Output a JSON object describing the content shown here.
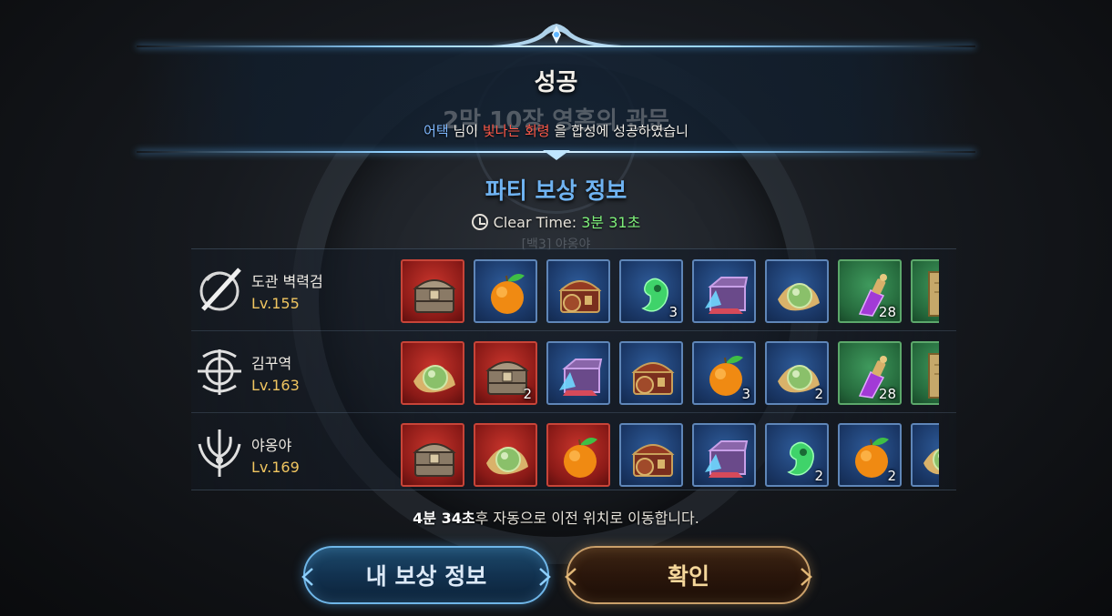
{
  "header": {
    "title": "성공",
    "ghost_title": "2막 10장 영혼의 관문",
    "notice": {
      "player": "어택",
      "pre": " 님이 ",
      "item": "빛나는 회령",
      "post": " 을 합성에 성공하였습니"
    }
  },
  "party": {
    "title": "파티 보상 정보",
    "clear_time_label": "Clear Time: ",
    "clear_time_value": "3분 31초",
    "ghost_sub": "[백3] 야옹야"
  },
  "members": [
    {
      "name": "도관 벽력검",
      "level": "Lv.155",
      "class_icon": "dragon-sword-icon",
      "items": [
        {
          "icon": "treasure-chest-icon",
          "bg": "red",
          "count": ""
        },
        {
          "icon": "orange-fruit-icon",
          "bg": "blue",
          "count": ""
        },
        {
          "icon": "ornate-chest-icon",
          "bg": "blue",
          "count": ""
        },
        {
          "icon": "jade-magatama-icon",
          "bg": "blue",
          "count": "3"
        },
        {
          "icon": "crystal-box-icon",
          "bg": "blue",
          "count": ""
        },
        {
          "icon": "green-pearl-icon",
          "bg": "blue",
          "count": ""
        },
        {
          "icon": "purple-potion-icon",
          "bg": "green",
          "count": "28"
        },
        {
          "icon": "scroll-icon",
          "bg": "green",
          "count": ""
        }
      ]
    },
    {
      "name": "김꾸역",
      "level": "Lv.163",
      "class_icon": "bow-emblem-icon",
      "items": [
        {
          "icon": "green-pearl-icon",
          "bg": "red",
          "count": ""
        },
        {
          "icon": "treasure-chest-icon",
          "bg": "red",
          "count": "2"
        },
        {
          "icon": "crystal-box-icon",
          "bg": "blue",
          "count": ""
        },
        {
          "icon": "ornate-chest-icon",
          "bg": "blue",
          "count": ""
        },
        {
          "icon": "orange-fruit-icon",
          "bg": "blue",
          "count": "3"
        },
        {
          "icon": "green-pearl-icon",
          "bg": "blue",
          "count": "2"
        },
        {
          "icon": "purple-potion-icon",
          "bg": "green",
          "count": "28"
        },
        {
          "icon": "scroll-icon",
          "bg": "green",
          "count": ""
        }
      ]
    },
    {
      "name": "야옹야",
      "level": "Lv.169",
      "class_icon": "trident-emblem-icon",
      "items": [
        {
          "icon": "treasure-chest-icon",
          "bg": "red",
          "count": ""
        },
        {
          "icon": "green-pearl-icon",
          "bg": "red",
          "count": ""
        },
        {
          "icon": "orange-fruit-icon",
          "bg": "red",
          "count": ""
        },
        {
          "icon": "ornate-chest-icon",
          "bg": "blue",
          "count": ""
        },
        {
          "icon": "crystal-box-icon",
          "bg": "blue",
          "count": ""
        },
        {
          "icon": "jade-magatama-icon",
          "bg": "blue",
          "count": "2"
        },
        {
          "icon": "orange-fruit-icon",
          "bg": "blue",
          "count": "2"
        },
        {
          "icon": "green-pearl-icon",
          "bg": "blue",
          "count": ""
        }
      ]
    }
  ],
  "footer": {
    "timer_value": "4분 34초",
    "timer_text": "후 자동으로 이전 위치로 이동합니다.",
    "my_reward_label": "내 보상 정보",
    "confirm_label": "확인"
  },
  "colors": {
    "accent_blue": "#6fb3f2",
    "level_gold": "#f0c560",
    "clear_time_green": "#7ef07a",
    "notice_item_red": "#ff5a4a"
  }
}
